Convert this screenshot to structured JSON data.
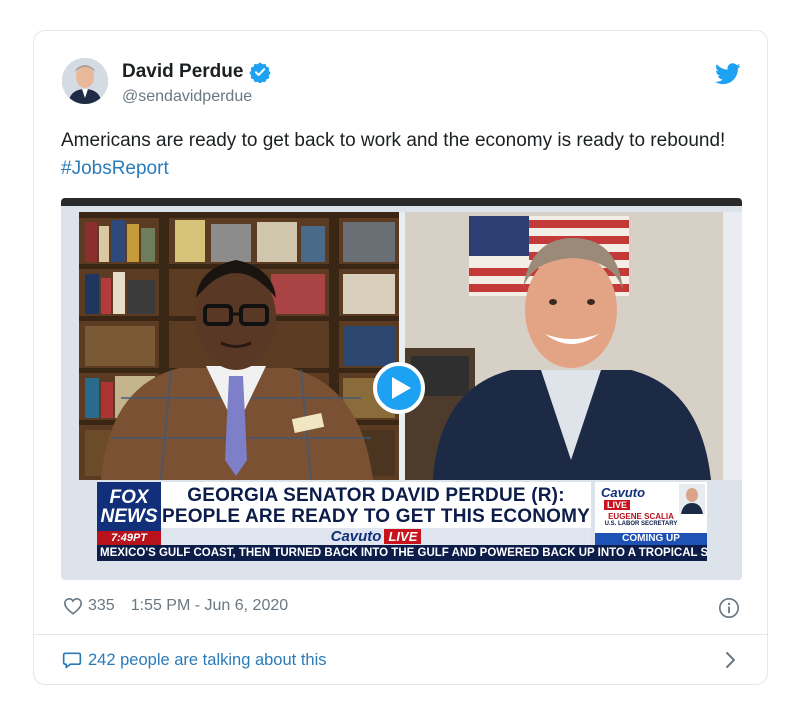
{
  "author": {
    "name": "David Perdue",
    "handle": "@sendavidperdue"
  },
  "tweet": {
    "text": "Americans are ready to get back to work and the economy is ready to rebound! ",
    "hashtag": "#JobsReport"
  },
  "video": {
    "channel_logo_line1": "FOX",
    "channel_logo_line2": "NEWS",
    "time": "7:49PT",
    "headline": "GEORGIA SENATOR DAVID PERDUE (R): PEOPLE ARE READY TO GET THIS ECONOMY OPEN",
    "show": "Cavuto",
    "show_live": "LIVE",
    "up_next_brand": "Cavuto",
    "up_next_live": "LIVE",
    "up_next_guest": "EUGENE SCALIA",
    "up_next_guest_title": "U.S. LABOR SECRETARY",
    "up_next_label": "COMING UP",
    "ticker": "MEXICO'S GULF COAST, THEN TURNED BACK INTO THE GULF AND POWERED BACK UP INTO A TROPICAL ST"
  },
  "footer": {
    "likes": "335",
    "timestamp": "1:55 PM - Jun 6, 2020",
    "talking": "242 people are talking about this"
  },
  "colors": {
    "link": "#2b7bb9",
    "muted": "#697882",
    "twitter_blue": "#1da1f2",
    "border": "#e1e8ed"
  },
  "icons": [
    "verified-badge-icon",
    "twitter-bird-icon",
    "play-icon",
    "heart-icon",
    "info-icon",
    "speech-bubble-icon",
    "chevron-right-icon"
  ]
}
